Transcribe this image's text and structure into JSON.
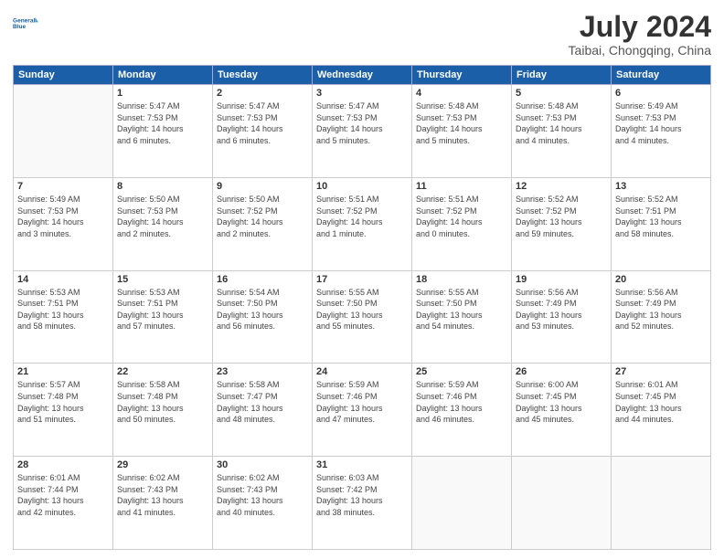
{
  "header": {
    "logo_line1": "General",
    "logo_line2": "Blue",
    "month": "July 2024",
    "location": "Taibai, Chongqing, China"
  },
  "weekdays": [
    "Sunday",
    "Monday",
    "Tuesday",
    "Wednesday",
    "Thursday",
    "Friday",
    "Saturday"
  ],
  "weeks": [
    [
      {
        "day": "",
        "info": ""
      },
      {
        "day": "1",
        "info": "Sunrise: 5:47 AM\nSunset: 7:53 PM\nDaylight: 14 hours\nand 6 minutes."
      },
      {
        "day": "2",
        "info": "Sunrise: 5:47 AM\nSunset: 7:53 PM\nDaylight: 14 hours\nand 6 minutes."
      },
      {
        "day": "3",
        "info": "Sunrise: 5:47 AM\nSunset: 7:53 PM\nDaylight: 14 hours\nand 5 minutes."
      },
      {
        "day": "4",
        "info": "Sunrise: 5:48 AM\nSunset: 7:53 PM\nDaylight: 14 hours\nand 5 minutes."
      },
      {
        "day": "5",
        "info": "Sunrise: 5:48 AM\nSunset: 7:53 PM\nDaylight: 14 hours\nand 4 minutes."
      },
      {
        "day": "6",
        "info": "Sunrise: 5:49 AM\nSunset: 7:53 PM\nDaylight: 14 hours\nand 4 minutes."
      }
    ],
    [
      {
        "day": "7",
        "info": "Sunrise: 5:49 AM\nSunset: 7:53 PM\nDaylight: 14 hours\nand 3 minutes."
      },
      {
        "day": "8",
        "info": "Sunrise: 5:50 AM\nSunset: 7:53 PM\nDaylight: 14 hours\nand 2 minutes."
      },
      {
        "day": "9",
        "info": "Sunrise: 5:50 AM\nSunset: 7:52 PM\nDaylight: 14 hours\nand 2 minutes."
      },
      {
        "day": "10",
        "info": "Sunrise: 5:51 AM\nSunset: 7:52 PM\nDaylight: 14 hours\nand 1 minute."
      },
      {
        "day": "11",
        "info": "Sunrise: 5:51 AM\nSunset: 7:52 PM\nDaylight: 14 hours\nand 0 minutes."
      },
      {
        "day": "12",
        "info": "Sunrise: 5:52 AM\nSunset: 7:52 PM\nDaylight: 13 hours\nand 59 minutes."
      },
      {
        "day": "13",
        "info": "Sunrise: 5:52 AM\nSunset: 7:51 PM\nDaylight: 13 hours\nand 58 minutes."
      }
    ],
    [
      {
        "day": "14",
        "info": "Sunrise: 5:53 AM\nSunset: 7:51 PM\nDaylight: 13 hours\nand 58 minutes."
      },
      {
        "day": "15",
        "info": "Sunrise: 5:53 AM\nSunset: 7:51 PM\nDaylight: 13 hours\nand 57 minutes."
      },
      {
        "day": "16",
        "info": "Sunrise: 5:54 AM\nSunset: 7:50 PM\nDaylight: 13 hours\nand 56 minutes."
      },
      {
        "day": "17",
        "info": "Sunrise: 5:55 AM\nSunset: 7:50 PM\nDaylight: 13 hours\nand 55 minutes."
      },
      {
        "day": "18",
        "info": "Sunrise: 5:55 AM\nSunset: 7:50 PM\nDaylight: 13 hours\nand 54 minutes."
      },
      {
        "day": "19",
        "info": "Sunrise: 5:56 AM\nSunset: 7:49 PM\nDaylight: 13 hours\nand 53 minutes."
      },
      {
        "day": "20",
        "info": "Sunrise: 5:56 AM\nSunset: 7:49 PM\nDaylight: 13 hours\nand 52 minutes."
      }
    ],
    [
      {
        "day": "21",
        "info": "Sunrise: 5:57 AM\nSunset: 7:48 PM\nDaylight: 13 hours\nand 51 minutes."
      },
      {
        "day": "22",
        "info": "Sunrise: 5:58 AM\nSunset: 7:48 PM\nDaylight: 13 hours\nand 50 minutes."
      },
      {
        "day": "23",
        "info": "Sunrise: 5:58 AM\nSunset: 7:47 PM\nDaylight: 13 hours\nand 48 minutes."
      },
      {
        "day": "24",
        "info": "Sunrise: 5:59 AM\nSunset: 7:46 PM\nDaylight: 13 hours\nand 47 minutes."
      },
      {
        "day": "25",
        "info": "Sunrise: 5:59 AM\nSunset: 7:46 PM\nDaylight: 13 hours\nand 46 minutes."
      },
      {
        "day": "26",
        "info": "Sunrise: 6:00 AM\nSunset: 7:45 PM\nDaylight: 13 hours\nand 45 minutes."
      },
      {
        "day": "27",
        "info": "Sunrise: 6:01 AM\nSunset: 7:45 PM\nDaylight: 13 hours\nand 44 minutes."
      }
    ],
    [
      {
        "day": "28",
        "info": "Sunrise: 6:01 AM\nSunset: 7:44 PM\nDaylight: 13 hours\nand 42 minutes."
      },
      {
        "day": "29",
        "info": "Sunrise: 6:02 AM\nSunset: 7:43 PM\nDaylight: 13 hours\nand 41 minutes."
      },
      {
        "day": "30",
        "info": "Sunrise: 6:02 AM\nSunset: 7:43 PM\nDaylight: 13 hours\nand 40 minutes."
      },
      {
        "day": "31",
        "info": "Sunrise: 6:03 AM\nSunset: 7:42 PM\nDaylight: 13 hours\nand 38 minutes."
      },
      {
        "day": "",
        "info": ""
      },
      {
        "day": "",
        "info": ""
      },
      {
        "day": "",
        "info": ""
      }
    ]
  ]
}
